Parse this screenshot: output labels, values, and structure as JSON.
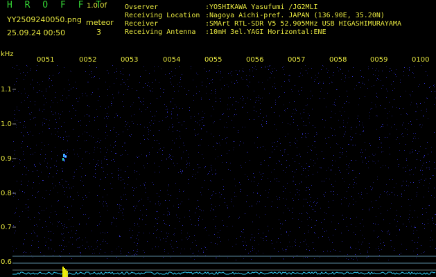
{
  "header": {
    "brand": "H R O F F T",
    "version": "1.0.0f",
    "filename": "YY2509240050.png",
    "datetime": "25.09.24 00:50",
    "meteor_label": "meteor",
    "meteor_count": "3"
  },
  "info": {
    "observer_label": "Ovserver",
    "observer_value": ":YOSHIKAWA Yasufumi /JG2MLI",
    "location_label": "Receiving Location",
    "location_value": ":Nagoya Aichi-pref. JAPAN (136.90E, 35.20N)",
    "receiver_label": "Receiver",
    "receiver_value": ":SMArt RTL-SDR V5 52.905MHz USB HIGASHIMURAYAMA",
    "antenna_label": "Receiving Antenna",
    "antenna_value": ":10mH 3el.YAGI Horizontal:ENE"
  },
  "axis": {
    "unit": "kHz",
    "y_ticks": [
      "1.1",
      "1.0",
      "0.9",
      "0.8",
      "0.7",
      "0.6"
    ],
    "x_ticks": [
      "0051",
      "0052",
      "0053",
      "0054",
      "0055",
      "0056",
      "0057",
      "0058",
      "0059",
      "0100"
    ]
  },
  "colors": {
    "background": "#000000",
    "text": "#e8e840",
    "brand": "#35d435",
    "grid": "#8a8a8a",
    "ref_line": "#5a8aa0",
    "noise": "#2a2aa8",
    "baseline": "#30c8f0",
    "meteor": "#40b0ff",
    "burst": "#f0f000"
  }
}
